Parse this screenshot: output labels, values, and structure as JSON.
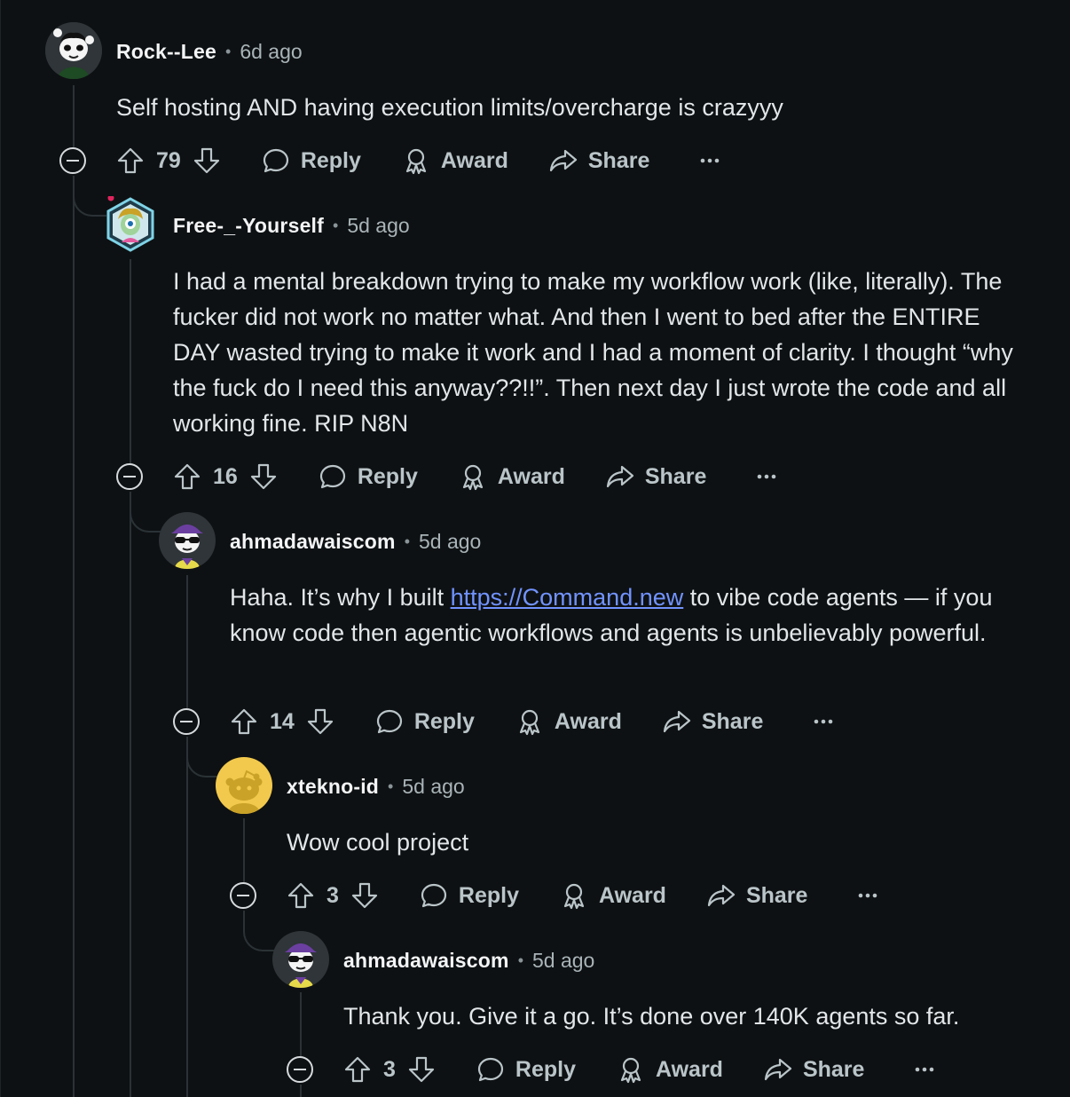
{
  "comments": [
    {
      "username": "Rock--Lee",
      "time": "6d ago",
      "body": "Self hosting AND having execution limits/overcharge is crazyyy",
      "score": "79",
      "avatar_icon": "panda-snoo-avatar"
    },
    {
      "username": "Free-_-Yourself",
      "time": "5d ago",
      "body": "I had a mental breakdown trying to make my workflow work (like, literally). The fucker did not work no matter what. And then I went to bed after the ENTIRE DAY wasted trying to make it work and I had a moment of clarity. I thought “why the fuck do I need this anyway??!!”. Then next day I just wrote the code and all working fine. RIP N8N",
      "score": "16",
      "avatar_icon": "hexagon-nft-avatar"
    },
    {
      "username": "ahmadawaiscom",
      "time": "5d ago",
      "body_before": "Haha. It’s why I built ",
      "body_link": "https://Command.new",
      "body_after": " to vibe code agents — if you know code then agentic workflows and agents is unbelievably powerful.",
      "score": "14",
      "avatar_icon": "purple-cap-sunglasses-avatar"
    },
    {
      "username": "xtekno-id",
      "time": "5d ago",
      "body": "Wow cool project",
      "score": "3",
      "avatar_icon": "default-snoo-avatar"
    },
    {
      "username": "ahmadawaiscom",
      "time": "5d ago",
      "body": "Thank you. Give it a go. It’s done over 140K agents so far.",
      "score": "3",
      "avatar_icon": "purple-cap-sunglasses-avatar"
    }
  ],
  "actions": {
    "reply": "Reply",
    "award": "Award",
    "share": "Share",
    "separator": "•"
  },
  "colors": {
    "background": "#0e1113",
    "link": "#7193ff",
    "text": "#e3e6e8",
    "muted": "#a9b4b8",
    "thread_line": "#2a3236"
  }
}
